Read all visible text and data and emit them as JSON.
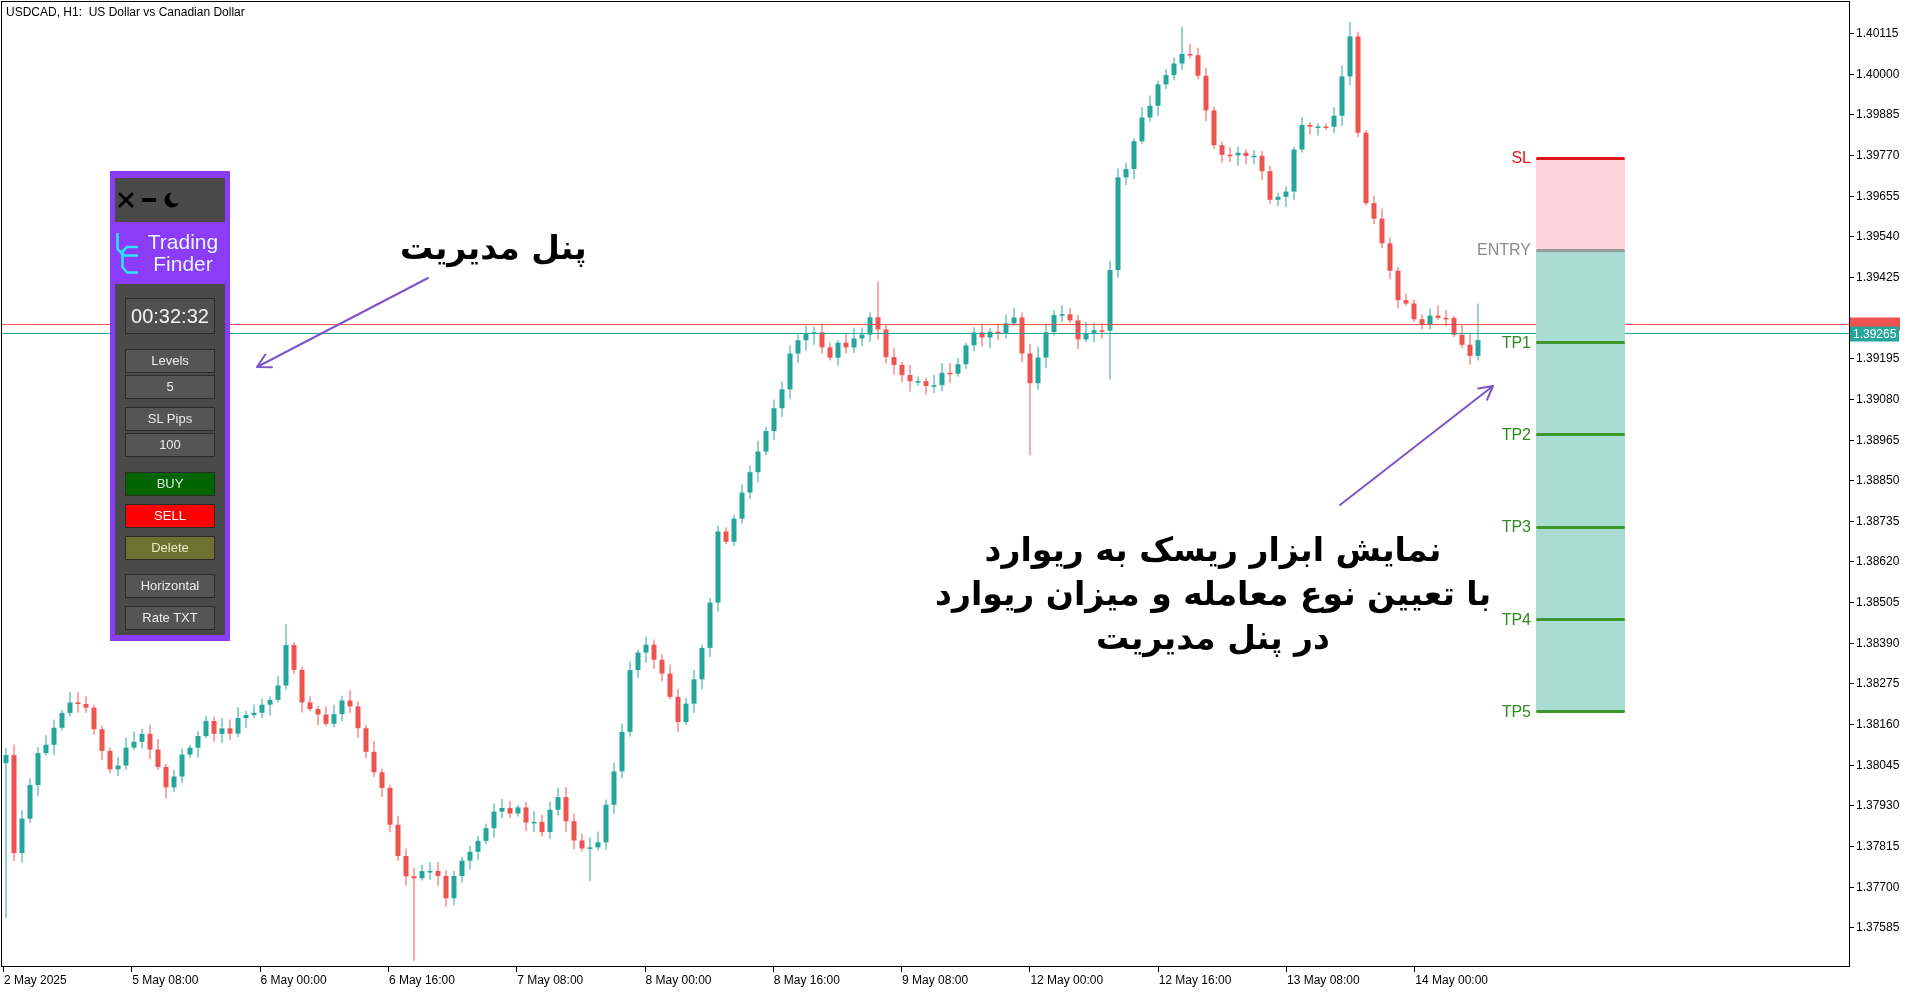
{
  "chart": {
    "title": "USDCAD, H1:  US Dollar vs Canadian Dollar",
    "price_axis": [
      "1.40115",
      "1.40000",
      "1.39885",
      "1.39770",
      "1.39655",
      "1.39540",
      "1.39425",
      "1.39195",
      "1.39080",
      "1.38965",
      "1.38850",
      "1.38735",
      "1.38620",
      "1.38505",
      "1.38390",
      "1.38275",
      "1.38160",
      "1.38045",
      "1.37930",
      "1.37815",
      "1.37700",
      "1.37585"
    ],
    "price_lines": [
      {
        "kind": "ask",
        "color": "#ef5350"
      },
      {
        "kind": "bid",
        "label": "1.39265",
        "color": "#26a69a"
      }
    ],
    "time_axis": [
      "2 May 2025",
      "5 May 08:00",
      "6 May 00:00",
      "6 May 16:00",
      "7 May 08:00",
      "8 May 00:00",
      "8 May 16:00",
      "9 May 08:00",
      "12 May 00:00",
      "12 May 16:00",
      "13 May 08:00",
      "14 May 00:00"
    ]
  },
  "panel": {
    "logo": "Trading Finder",
    "timer": "00:32:32",
    "fields": [
      {
        "label": "Levels",
        "value": "5"
      },
      {
        "label": "SL Pips",
        "value": "100"
      }
    ],
    "actions": [
      {
        "label": "BUY",
        "kind": "buy"
      },
      {
        "label": "SELL",
        "kind": "sell"
      },
      {
        "label": "Delete",
        "kind": "delete"
      }
    ],
    "options": [
      "Horizontal",
      "Rate TXT"
    ]
  },
  "risk_reward": {
    "levels": [
      {
        "label": "SL",
        "kind": "sl"
      },
      {
        "label": "ENTRY",
        "kind": "entry"
      },
      {
        "label": "TP1",
        "kind": "tp"
      },
      {
        "label": "TP2",
        "kind": "tp"
      },
      {
        "label": "TP3",
        "kind": "tp"
      },
      {
        "label": "TP4",
        "kind": "tp"
      },
      {
        "label": "TP5",
        "kind": "tp"
      }
    ]
  },
  "annotations": [
    {
      "kind": "label",
      "lines": [
        "پنل مدیریت"
      ]
    },
    {
      "kind": "caption",
      "lines": [
        "نمایش ابزار ریسک به ریوارد",
        "با تعیین نوع معامله و میزان ریوارد",
        "در پنل مدیریت"
      ]
    }
  ]
}
